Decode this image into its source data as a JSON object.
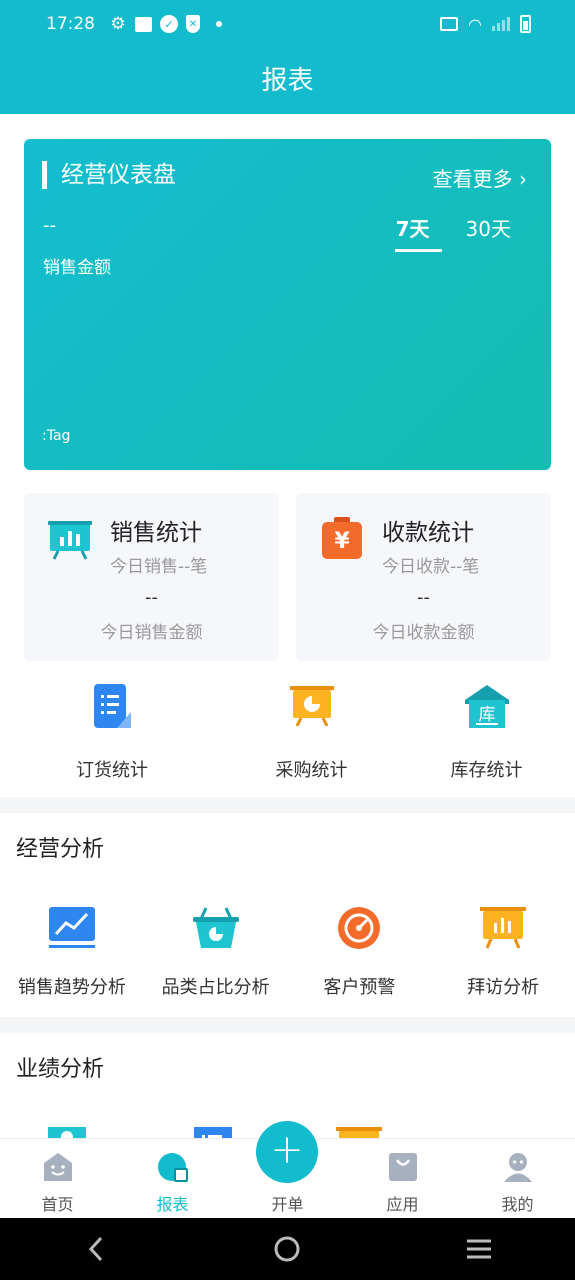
{
  "status_bar": {
    "time": "17:28"
  },
  "header": {
    "title": "报表"
  },
  "dashboard": {
    "title": "经营仪表盘",
    "more": "查看更多",
    "value": "--",
    "label": "销售金额",
    "tabs": [
      {
        "label": "7天",
        "active": true
      },
      {
        "label": "30天",
        "active": false
      }
    ],
    "tag": ":Tag"
  },
  "stats": [
    {
      "title": "销售统计",
      "sub": "今日销售--笔",
      "value": "--",
      "label": "今日销售金额",
      "icon": "chart-board-icon",
      "color": "#1ec4cf"
    },
    {
      "title": "收款统计",
      "sub": "今日收款--笔",
      "value": "--",
      "label": "今日收款金额",
      "icon": "yen-bag-icon",
      "color": "#f36b2a"
    }
  ],
  "quick": [
    {
      "label": "订货统计",
      "icon": "document-list-icon"
    },
    {
      "label": "采购统计",
      "icon": "pie-board-icon"
    },
    {
      "label": "库存统计",
      "icon": "warehouse-icon"
    }
  ],
  "analysis": {
    "title": "经营分析",
    "items": [
      {
        "label": "销售趋势分析",
        "icon": "trend-line-icon"
      },
      {
        "label": "品类占比分析",
        "icon": "basket-icon"
      },
      {
        "label": "客户预警",
        "icon": "gauge-icon"
      },
      {
        "label": "拜访分析",
        "icon": "bar-board-icon"
      }
    ]
  },
  "performance": {
    "title": "业绩分析"
  },
  "tabbar": [
    {
      "label": "首页",
      "icon": "home-icon",
      "active": false
    },
    {
      "label": "报表",
      "icon": "report-icon",
      "active": true
    },
    {
      "label": "开单",
      "icon": "plus-icon",
      "active": false
    },
    {
      "label": "应用",
      "icon": "bag-icon",
      "active": false
    },
    {
      "label": "我的",
      "icon": "profile-icon",
      "active": false
    }
  ],
  "fab_symbol": "+",
  "more_chevron": "›"
}
